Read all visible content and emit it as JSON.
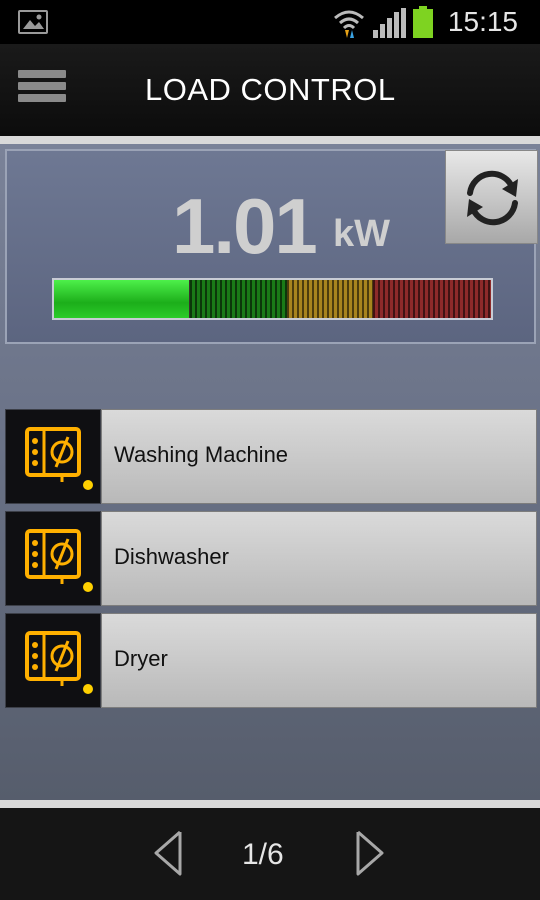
{
  "status_bar": {
    "time": "15:15",
    "icons": [
      "gallery-icon",
      "wifi-icon",
      "signal-icon",
      "battery-icon"
    ]
  },
  "header": {
    "title": "LOAD CONTROL",
    "menu_icon": "menu-icon"
  },
  "meter": {
    "value": "1.01",
    "unit": "kW",
    "level_percent": 31,
    "refresh_icon": "refresh-icon",
    "colors": {
      "green": "#2bcc29",
      "orange": "#a8841e",
      "red": "#8e2a2a"
    }
  },
  "devices": [
    {
      "label": "Washing Machine",
      "icon": "device-plug-icon",
      "status_color": "#ffd000"
    },
    {
      "label": "Dishwasher",
      "icon": "device-plug-icon",
      "status_color": "#ffd000"
    },
    {
      "label": "Dryer",
      "icon": "device-plug-icon",
      "status_color": "#ffd000"
    }
  ],
  "pagination": {
    "indicator": "1/6",
    "prev_icon": "chevron-left-icon",
    "next_icon": "chevron-right-icon"
  },
  "colors": {
    "accent": "#ffb000",
    "background": "#6c7489"
  }
}
